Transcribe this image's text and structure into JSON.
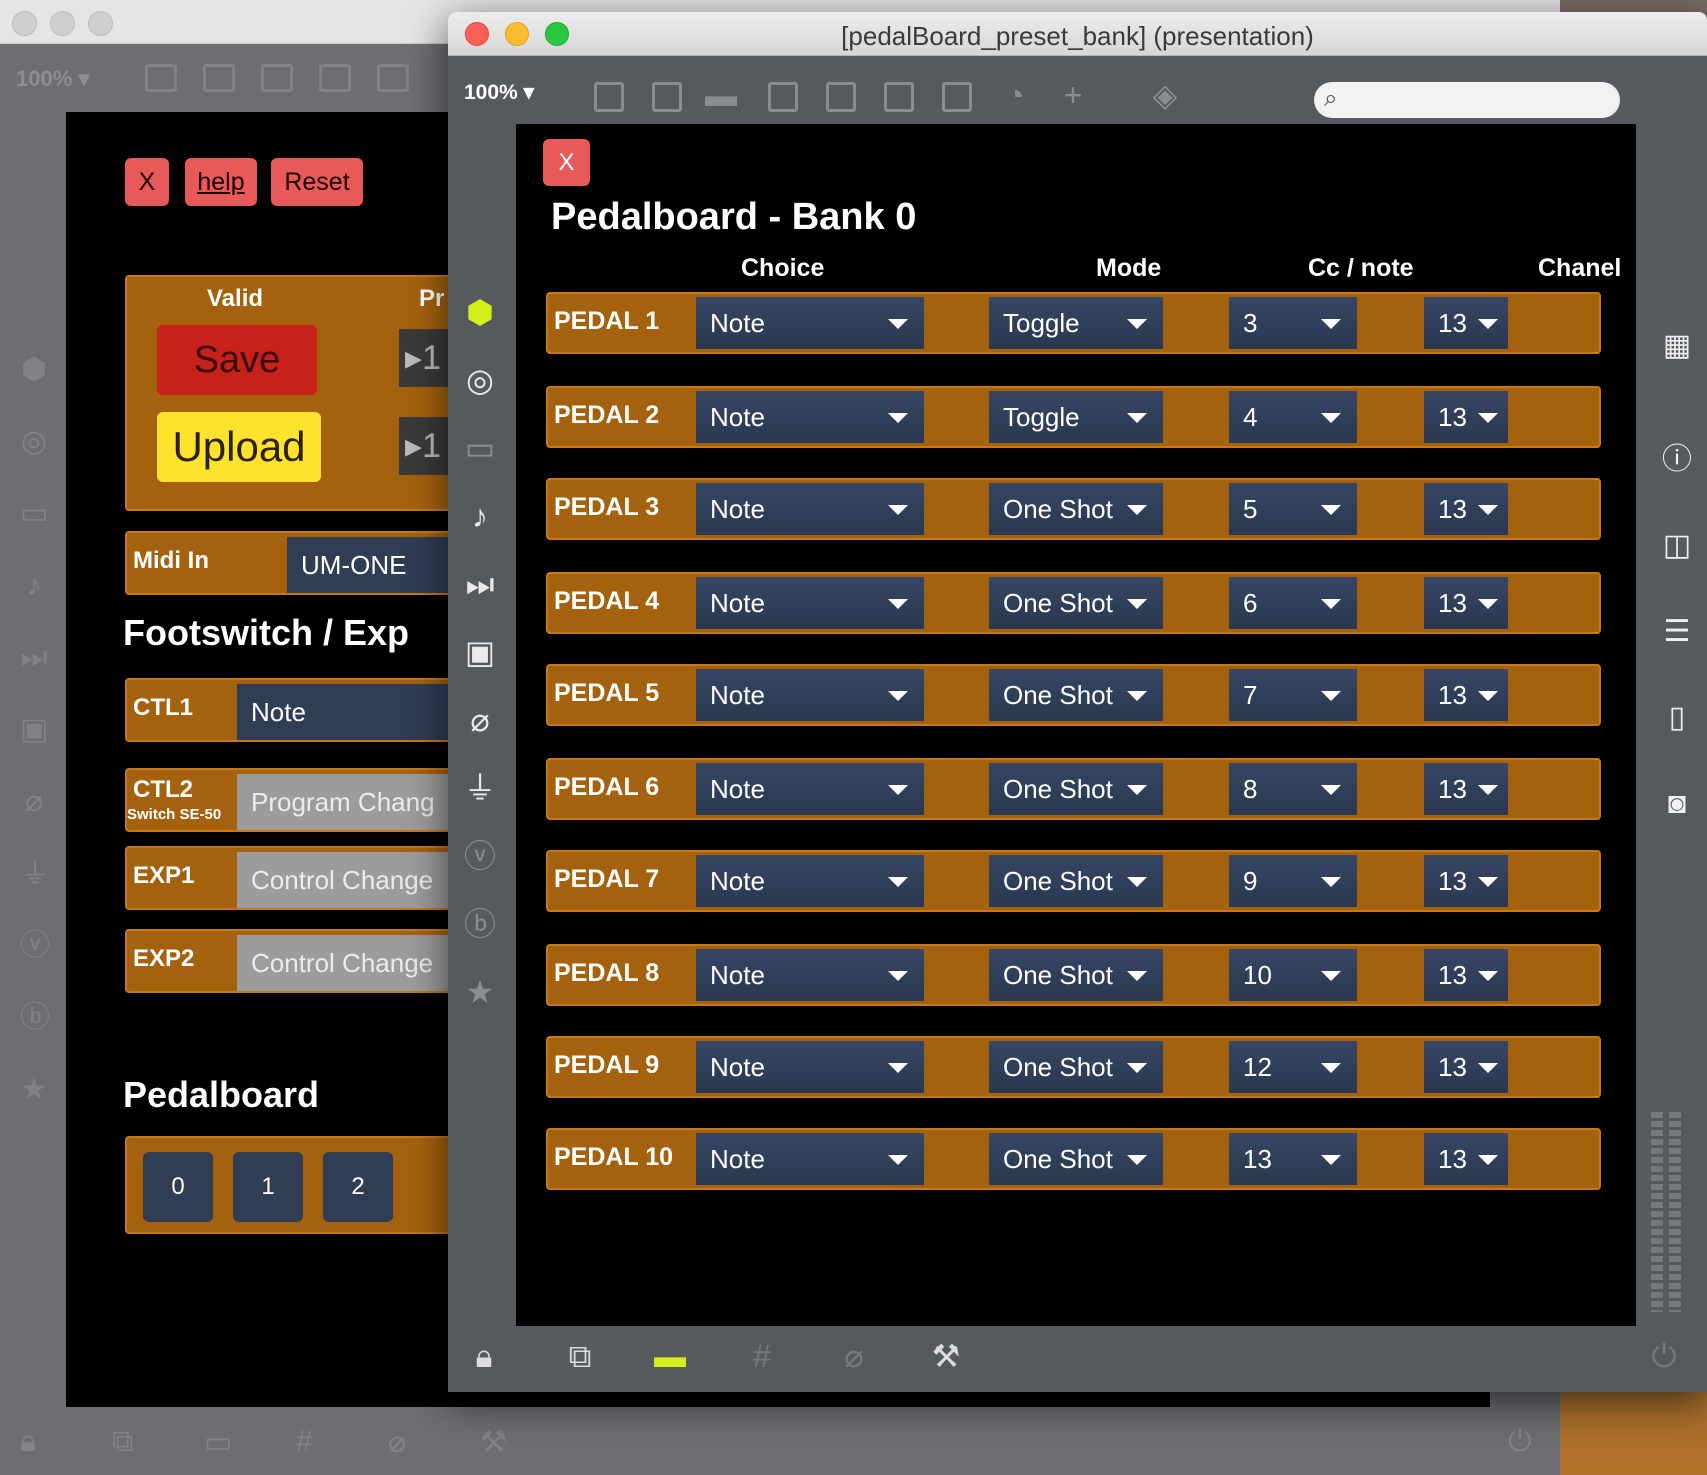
{
  "back_window": {
    "zoom": "100% ▾",
    "buttons": {
      "close": "X",
      "help": "help",
      "reset": "Reset"
    },
    "panel": {
      "valid_label": "Valid",
      "preset_label": "Pr",
      "save": "Save",
      "upload": "Upload",
      "arrow1": "▸1",
      "arrow2": "▸1"
    },
    "midi_in": {
      "label": "Midi In",
      "value": "UM-ONE"
    },
    "footswitch_heading": "Footswitch / Exp",
    "controls": [
      {
        "label": "CTL1",
        "sub": "",
        "value": "Note"
      },
      {
        "label": "CTL2",
        "sub": "Switch SE-50",
        "value": "Program Chang"
      },
      {
        "label": "EXP1",
        "sub": "",
        "value": "Control Change"
      },
      {
        "label": "EXP2",
        "sub": "",
        "value": "Control Change"
      }
    ],
    "pedalboard_heading": "Pedalboard",
    "bank_buttons": [
      "0",
      "1",
      "2"
    ]
  },
  "front_window": {
    "title": "[pedalBoard_preset_bank] (presentation)",
    "zoom": "100% ▾",
    "search_placeholder": "",
    "close": "X",
    "heading": "Pedalboard - Bank 0",
    "columns": {
      "choice": "Choice",
      "mode": "Mode",
      "cc": "Cc / note",
      "channel": "Chanel"
    },
    "pedals": [
      {
        "label": "PEDAL 1",
        "choice": "Note",
        "mode": "Toggle",
        "cc": "3",
        "channel": "13"
      },
      {
        "label": "PEDAL 2",
        "choice": "Note",
        "mode": "Toggle",
        "cc": "4",
        "channel": "13"
      },
      {
        "label": "PEDAL 3",
        "choice": "Note",
        "mode": "One Shot",
        "cc": "5",
        "channel": "13"
      },
      {
        "label": "PEDAL 4",
        "choice": "Note",
        "mode": "One Shot",
        "cc": "6",
        "channel": "13"
      },
      {
        "label": "PEDAL 5",
        "choice": "Note",
        "mode": "One Shot",
        "cc": "7",
        "channel": "13"
      },
      {
        "label": "PEDAL 6",
        "choice": "Note",
        "mode": "One Shot",
        "cc": "8",
        "channel": "13"
      },
      {
        "label": "PEDAL 7",
        "choice": "Note",
        "mode": "One Shot",
        "cc": "9",
        "channel": "13"
      },
      {
        "label": "PEDAL 8",
        "choice": "Note",
        "mode": "One Shot",
        "cc": "10",
        "channel": "13"
      },
      {
        "label": "PEDAL 9",
        "choice": "Note",
        "mode": "One Shot",
        "cc": "12",
        "channel": "13"
      },
      {
        "label": "PEDAL 10",
        "choice": "Note",
        "mode": "One Shot",
        "cc": "13",
        "channel": "13"
      }
    ]
  },
  "colors": {
    "panel_brown": "#a5620e",
    "dropdown_navy": "#2f3d55",
    "close_red": "#e85a5a",
    "save_red": "#c8201a",
    "upload_yellow": "#fde22e",
    "active_icon_green": "#d4f01a"
  }
}
